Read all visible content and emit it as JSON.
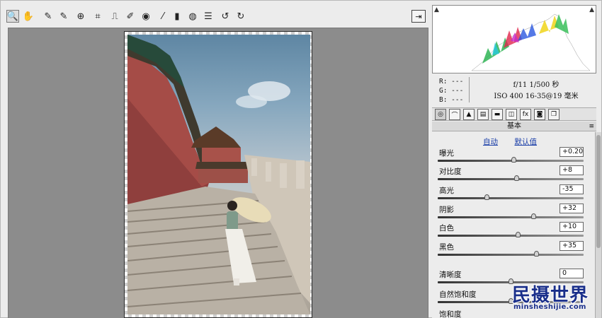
{
  "toolbar": {
    "tools": [
      {
        "name": "zoom-tool",
        "icon": "🔍",
        "active": true
      },
      {
        "name": "hand-tool",
        "icon": "✋"
      },
      {
        "name": "white-balance-tool",
        "icon": "✎"
      },
      {
        "name": "color-sampler-tool",
        "icon": "✎"
      },
      {
        "name": "targeted-adjustment-tool",
        "icon": "⊕"
      },
      {
        "name": "crop-tool",
        "icon": "⌗"
      },
      {
        "name": "straighten-tool",
        "icon": "⎍"
      },
      {
        "name": "spot-removal-tool",
        "icon": "✐"
      },
      {
        "name": "red-eye-tool",
        "icon": "◉"
      },
      {
        "name": "adjustment-brush-tool",
        "icon": "⁄"
      },
      {
        "name": "graduated-filter-tool",
        "icon": "▮"
      },
      {
        "name": "radial-filter-tool",
        "icon": "◍"
      },
      {
        "name": "preferences-tool",
        "icon": "☰"
      },
      {
        "name": "rotate-left-tool",
        "icon": "↺"
      },
      {
        "name": "rotate-right-tool",
        "icon": "↻"
      }
    ],
    "open_icon": "⇥"
  },
  "histogram": {
    "shadow_clip_icon": "▲",
    "highlight_clip_icon": "▲"
  },
  "info": {
    "r": "R:  ---",
    "g": "G:  ---",
    "b": "B:  ---",
    "exposure": "f/11   1/500 秒",
    "lens": "ISO 400   16-35@19 毫米"
  },
  "tabs": [
    "◎",
    "⌒",
    "▲",
    "▤",
    "▬",
    "◫",
    "fx",
    "◙",
    "❐"
  ],
  "panel": {
    "title": "基本",
    "menu_icon": "≡",
    "auto_label": "自动",
    "default_label": "默认值",
    "sliders": [
      {
        "label": "曝光",
        "value": "+0.20",
        "pos": 0.52
      },
      {
        "label": "对比度",
        "value": "+8",
        "pos": 0.54
      },
      {
        "label": "高光",
        "value": "-35",
        "pos": 0.33
      },
      {
        "label": "阴影",
        "value": "+32",
        "pos": 0.66
      },
      {
        "label": "白色",
        "value": "+10",
        "pos": 0.55
      },
      {
        "label": "黑色",
        "value": "+35",
        "pos": 0.68
      },
      {
        "label": "清晰度",
        "value": "0",
        "pos": 0.5
      },
      {
        "label": "自然饱和度",
        "value": "",
        "pos": 0.5
      },
      {
        "label": "饱和度",
        "value": "",
        "pos": 0.5
      }
    ]
  },
  "watermark": {
    "main": "民摄世界",
    "sub": "minsheshijie.com"
  }
}
